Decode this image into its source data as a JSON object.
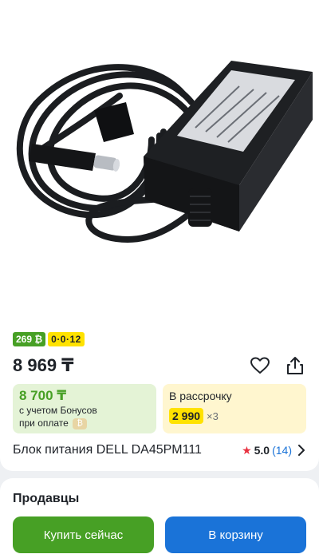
{
  "badges": {
    "bonus_value": "269 ₿",
    "installment_code": "0·0·12"
  },
  "price": "8 969 ₸",
  "icons": {
    "favorite": "heart-outline-icon",
    "share": "share-icon"
  },
  "bonus_offer": {
    "price": "8 700 ₸",
    "note_line1": "с учетом Бонусов",
    "note_line2": "при оплате",
    "chip_glyph": "₿"
  },
  "credit_offer": {
    "title": "В рассрочку",
    "amount": "2 990",
    "months": "×3"
  },
  "product": {
    "title": "Блок питания DELL DA45PM111",
    "rating": "5.0",
    "reviews": "(14)"
  },
  "sellers": {
    "title": "Продавцы"
  },
  "actions": {
    "buy_now": "Купить сейчас",
    "add_to_cart": "В корзину"
  },
  "colors": {
    "green": "#47a025",
    "blue": "#1a73d8",
    "yellow": "#ffe200",
    "star": "#e8303f"
  }
}
